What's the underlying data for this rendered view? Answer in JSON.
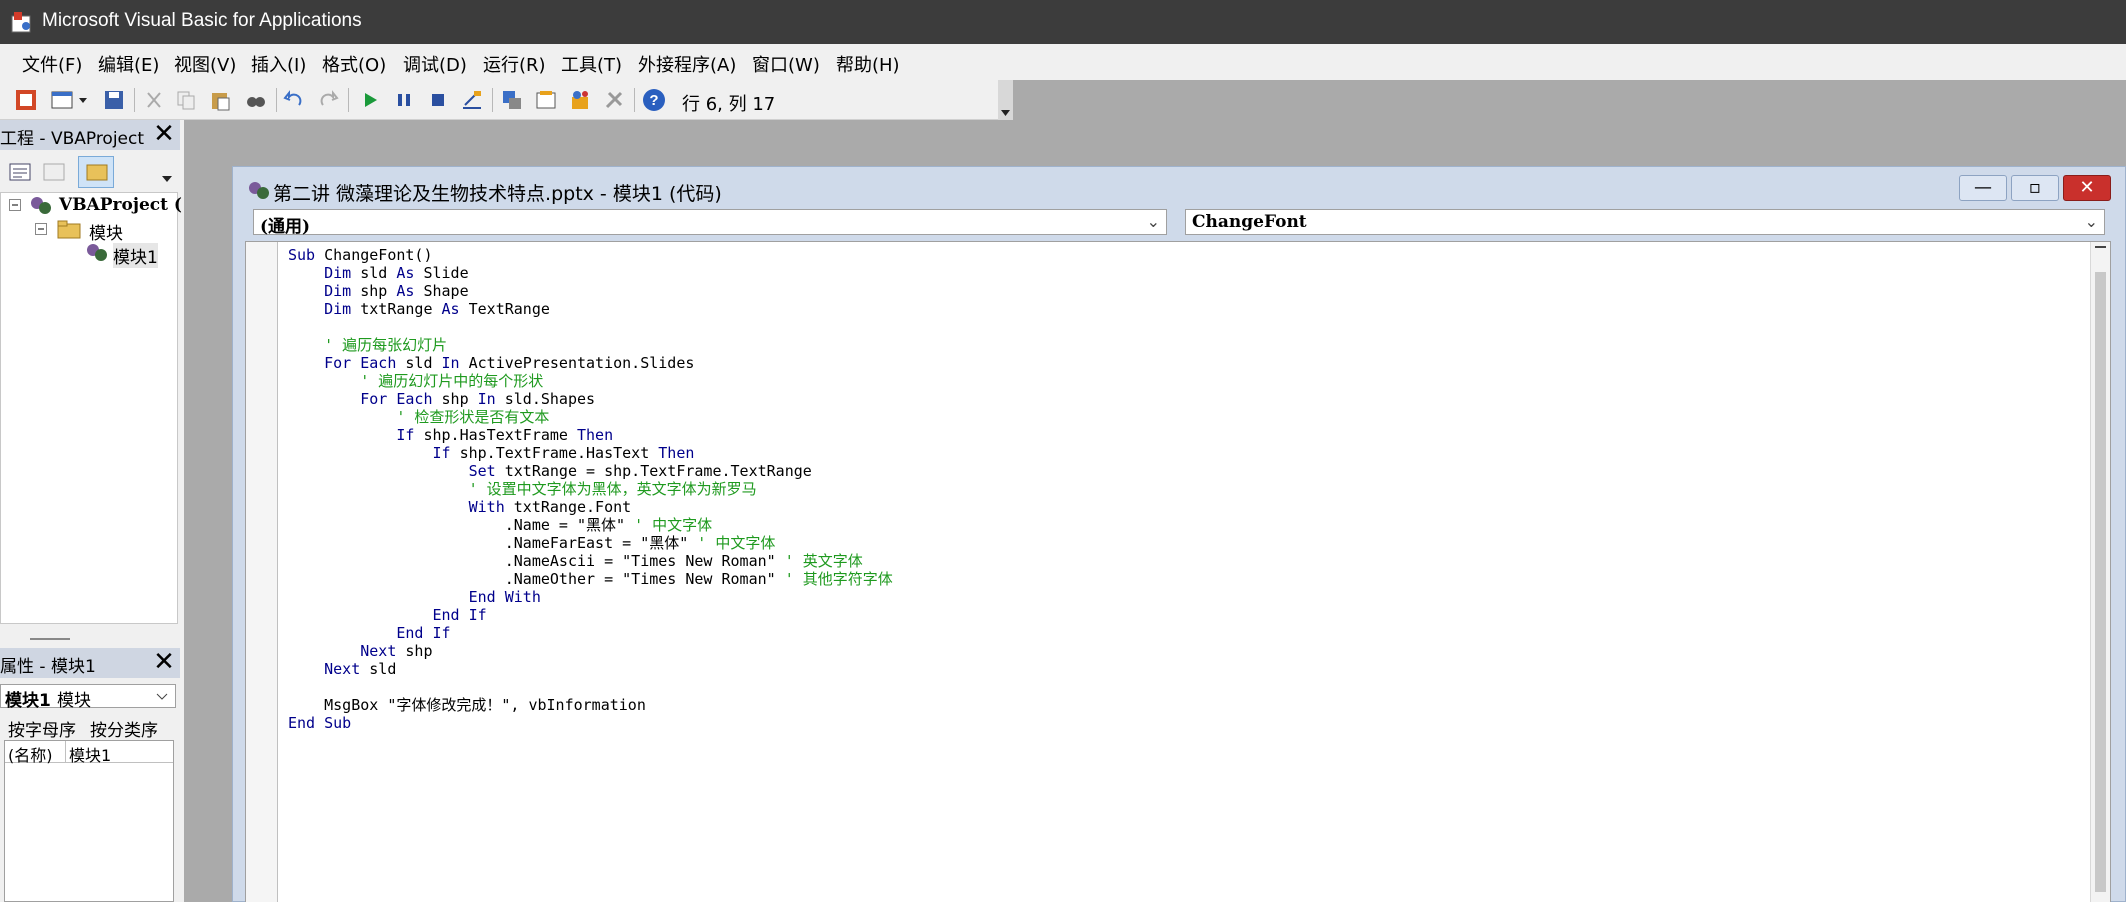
{
  "window": {
    "title": "Microsoft Visual Basic for Applications"
  },
  "menu": [
    "文件(F)",
    "编辑(E)",
    "视图(V)",
    "插入(I)",
    "格式(O)",
    "调试(D)",
    "运行(R)",
    "工具(T)",
    "外接程序(A)",
    "窗口(W)",
    "帮助(H)"
  ],
  "toolbar": {
    "position": "行 6, 列 17"
  },
  "project": {
    "title": "工程 - VBAProject",
    "root": "VBAProject (",
    "folder": "模块",
    "module": "模块1"
  },
  "properties": {
    "title": "属性 - 模块1",
    "object_name": "模块1",
    "object_type": "模块",
    "tab_alpha": "按字母序",
    "tab_category": "按分类序",
    "row_name": "(名称)",
    "row_value": "模块1"
  },
  "codewindow": {
    "title": "第二讲 微藻理论及生物技术特点.pptx - 模块1 (代码)",
    "object_combo": "(通用)",
    "proc_combo": "ChangeFont",
    "lines": [
      [
        {
          "t": "Sub ",
          "c": "kw"
        },
        {
          "t": "ChangeFont()",
          "c": ""
        }
      ],
      [
        {
          "t": "    ",
          "c": ""
        },
        {
          "t": "Dim ",
          "c": "kw"
        },
        {
          "t": "sld ",
          "c": ""
        },
        {
          "t": "As ",
          "c": "kw"
        },
        {
          "t": "Slide",
          "c": ""
        }
      ],
      [
        {
          "t": "    ",
          "c": ""
        },
        {
          "t": "Dim ",
          "c": "kw"
        },
        {
          "t": "shp ",
          "c": ""
        },
        {
          "t": "As ",
          "c": "kw"
        },
        {
          "t": "Shape",
          "c": ""
        }
      ],
      [
        {
          "t": "    ",
          "c": ""
        },
        {
          "t": "Dim ",
          "c": "kw"
        },
        {
          "t": "txtRange ",
          "c": ""
        },
        {
          "t": "As ",
          "c": "kw"
        },
        {
          "t": "TextRange",
          "c": ""
        }
      ],
      [
        {
          "t": "",
          "c": ""
        }
      ],
      [
        {
          "t": "    ' 遍历每张幻灯片",
          "c": "cm"
        }
      ],
      [
        {
          "t": "    ",
          "c": ""
        },
        {
          "t": "For Each ",
          "c": "kw"
        },
        {
          "t": "sld ",
          "c": ""
        },
        {
          "t": "In ",
          "c": "kw"
        },
        {
          "t": "ActivePresentation.Slides",
          "c": ""
        }
      ],
      [
        {
          "t": "        ' 遍历幻灯片中的每个形状",
          "c": "cm"
        }
      ],
      [
        {
          "t": "        ",
          "c": ""
        },
        {
          "t": "For Each ",
          "c": "kw"
        },
        {
          "t": "shp ",
          "c": ""
        },
        {
          "t": "In ",
          "c": "kw"
        },
        {
          "t": "sld.Shapes",
          "c": ""
        }
      ],
      [
        {
          "t": "            ' 检查形状是否有文本",
          "c": "cm"
        }
      ],
      [
        {
          "t": "            ",
          "c": ""
        },
        {
          "t": "If ",
          "c": "kw"
        },
        {
          "t": "shp.HasTextFrame ",
          "c": ""
        },
        {
          "t": "Then",
          "c": "kw"
        }
      ],
      [
        {
          "t": "                ",
          "c": ""
        },
        {
          "t": "If ",
          "c": "kw"
        },
        {
          "t": "shp.TextFrame.HasText ",
          "c": ""
        },
        {
          "t": "Then",
          "c": "kw"
        }
      ],
      [
        {
          "t": "                    ",
          "c": ""
        },
        {
          "t": "Set ",
          "c": "kw"
        },
        {
          "t": "txtRange = shp.TextFrame.TextRange",
          "c": ""
        }
      ],
      [
        {
          "t": "                    ' 设置中文字体为黑体，英文字体为新罗马",
          "c": "cm"
        }
      ],
      [
        {
          "t": "                    ",
          "c": ""
        },
        {
          "t": "With ",
          "c": "kw"
        },
        {
          "t": "txtRange.Font",
          "c": ""
        }
      ],
      [
        {
          "t": "                        .Name = \"黑体\" ",
          "c": ""
        },
        {
          "t": "' 中文字体",
          "c": "cm"
        }
      ],
      [
        {
          "t": "                        .NameFarEast = \"黑体\" ",
          "c": ""
        },
        {
          "t": "' 中文字体",
          "c": "cm"
        }
      ],
      [
        {
          "t": "                        .NameAscii = \"Times New Roman\" ",
          "c": ""
        },
        {
          "t": "' 英文字体",
          "c": "cm"
        }
      ],
      [
        {
          "t": "                        .NameOther = \"Times New Roman\" ",
          "c": ""
        },
        {
          "t": "' 其他字符字体",
          "c": "cm"
        }
      ],
      [
        {
          "t": "                    ",
          "c": ""
        },
        {
          "t": "End With",
          "c": "kw"
        }
      ],
      [
        {
          "t": "                ",
          "c": ""
        },
        {
          "t": "End If",
          "c": "kw"
        }
      ],
      [
        {
          "t": "            ",
          "c": ""
        },
        {
          "t": "End If",
          "c": "kw"
        }
      ],
      [
        {
          "t": "        ",
          "c": ""
        },
        {
          "t": "Next ",
          "c": "kw"
        },
        {
          "t": "shp",
          "c": ""
        }
      ],
      [
        {
          "t": "    ",
          "c": ""
        },
        {
          "t": "Next ",
          "c": "kw"
        },
        {
          "t": "sld",
          "c": ""
        }
      ],
      [
        {
          "t": "",
          "c": ""
        }
      ],
      [
        {
          "t": "    MsgBox \"字体修改完成！\", vbInformation",
          "c": ""
        }
      ],
      [
        {
          "t": "End Sub",
          "c": "kw"
        }
      ]
    ]
  }
}
